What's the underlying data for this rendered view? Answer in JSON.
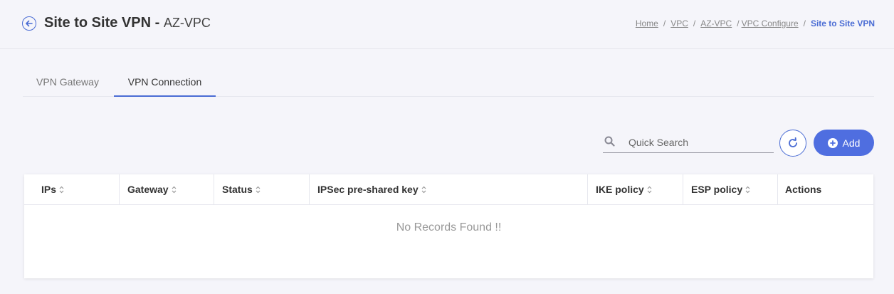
{
  "header": {
    "title": "Site to Site VPN",
    "separator": "-",
    "subtitle": "AZ-VPC",
    "breadcrumb": [
      {
        "label": "Home"
      },
      {
        "label": "VPC"
      },
      {
        "label": "AZ-VPC"
      },
      {
        "label": "VPC Configure"
      }
    ],
    "breadcrumb_current": "Site to Site VPN",
    "back_icon": "arrow-left-circle-icon"
  },
  "tabs": [
    {
      "label": "VPN Gateway",
      "active": false
    },
    {
      "label": "VPN Connection",
      "active": true
    }
  ],
  "toolbar": {
    "search_placeholder": "Quick Search",
    "search_value": "",
    "search_icon": "search-icon",
    "refresh_icon": "refresh-icon",
    "add_label": "Add",
    "add_icon": "plus-circle-icon"
  },
  "table": {
    "columns": [
      {
        "label": "IPs",
        "sortable": true
      },
      {
        "label": "Gateway",
        "sortable": true
      },
      {
        "label": "Status",
        "sortable": true
      },
      {
        "label": "IPSec pre-shared key",
        "sortable": true
      },
      {
        "label": "IKE policy",
        "sortable": true
      },
      {
        "label": "ESP policy",
        "sortable": true
      },
      {
        "label": "Actions",
        "sortable": false
      }
    ],
    "rows": [],
    "empty_message": "No Records Found !!"
  },
  "colors": {
    "accent": "#4a6cd4",
    "add_button": "#4f6ee0",
    "background": "#f5f5fa"
  }
}
